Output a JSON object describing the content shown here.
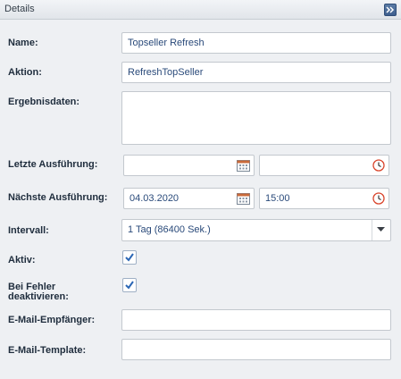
{
  "panel": {
    "title": "Details",
    "collapse_icon": "double-chevron-right-icon"
  },
  "form": {
    "name": {
      "label": "Name:",
      "value": "Topseller Refresh"
    },
    "aktion": {
      "label": "Aktion:",
      "value": "RefreshTopSeller"
    },
    "ergebnisdaten": {
      "label": "Ergebnisdaten:",
      "value": ""
    },
    "letzte_ausfuehrung": {
      "label": "Letzte Ausführung:",
      "date": "",
      "time": ""
    },
    "naechste_ausfuehrung": {
      "label": "Nächste Ausführung:",
      "date": "04.03.2020",
      "time": "15:00"
    },
    "intervall": {
      "label": "Intervall:",
      "value": "1 Tag (86400 Sek.)"
    },
    "aktiv": {
      "label": "Aktiv:",
      "checked": true
    },
    "bei_fehler": {
      "label_line1": "Bei Fehler",
      "label_line2": "deaktivieren:",
      "checked": true
    },
    "email_empfaenger": {
      "label": "E-Mail-Empfänger:",
      "value": ""
    },
    "email_template": {
      "label": "E-Mail-Template:",
      "value": ""
    }
  },
  "colors": {
    "accent": "#3d5f8e",
    "check": "#2a66b5",
    "clock": "#d9442b",
    "calendar": "#c96a3a"
  }
}
